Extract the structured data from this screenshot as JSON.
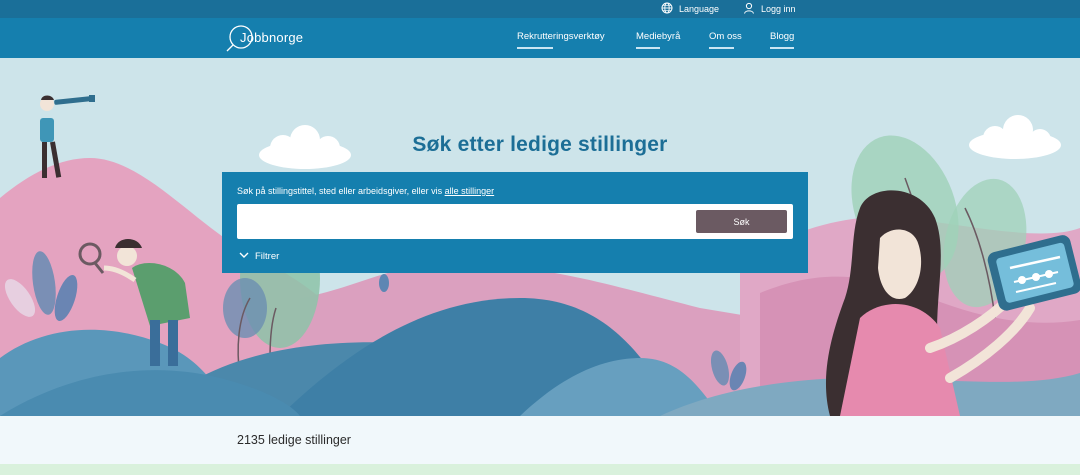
{
  "utility_bar": {
    "language_label": "Language",
    "login_label": "Logg inn"
  },
  "header": {
    "logo_text": "Jobbnorge",
    "nav": [
      {
        "label": "Rekrutteringsverktøy"
      },
      {
        "label": "Mediebyrå"
      },
      {
        "label": "Om oss"
      },
      {
        "label": "Blogg"
      }
    ]
  },
  "hero": {
    "title": "Søk etter ledige stillinger",
    "search": {
      "caption_prefix": "Søk på stillingstittel, sted eller arbeidsgiver, eller vis",
      "caption_link": "alle stillinger",
      "input_value": "",
      "button_label": "Søk",
      "filter_label": "Filtrer"
    }
  },
  "results": {
    "count_text": "2135 ledige stillinger"
  },
  "colors": {
    "utility_bar": "#1a6f99",
    "nav": "#157fae",
    "hero_sky": "#cde4ea",
    "title": "#1c6e96",
    "search_button": "#6b5a62",
    "results_bg": "#f1f8fb"
  }
}
